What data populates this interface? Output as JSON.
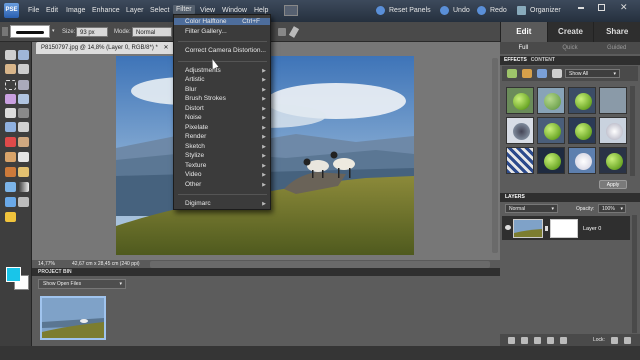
{
  "app": {
    "logo": "PSE"
  },
  "menubar": {
    "items": [
      "File",
      "Edit",
      "Image",
      "Enhance",
      "Layer",
      "Select",
      "Filter",
      "View",
      "Window",
      "Help"
    ],
    "active": "Filter",
    "reset_panels": "Reset Panels",
    "undo": "Undo",
    "redo": "Redo",
    "organizer": "Organizer"
  },
  "options": {
    "size_label": "Size:",
    "size_value": "93 px",
    "mode_label": "Mode:",
    "mode_value": "Normal"
  },
  "document": {
    "tab_title": "P8150797.jpg @ 14,8% (Layer 0, RGB/8*) *",
    "zoom": "14,77%",
    "doc_size": "42,67 cm x 28,45 cm (240 ppi)"
  },
  "filter_menu": {
    "items": [
      {
        "label": "Color Halftone",
        "shortcut": "Ctrl+F"
      },
      {
        "label": "Filter Gallery..."
      },
      {
        "label": "Correct Camera Distortion..."
      },
      {
        "label": "Adjustments",
        "submenu": true
      },
      {
        "label": "Artistic",
        "submenu": true
      },
      {
        "label": "Blur",
        "submenu": true
      },
      {
        "label": "Brush Strokes",
        "submenu": true
      },
      {
        "label": "Distort",
        "submenu": true
      },
      {
        "label": "Noise",
        "submenu": true
      },
      {
        "label": "Pixelate",
        "submenu": true
      },
      {
        "label": "Render",
        "submenu": true
      },
      {
        "label": "Sketch",
        "submenu": true
      },
      {
        "label": "Stylize",
        "submenu": true
      },
      {
        "label": "Texture",
        "submenu": true
      },
      {
        "label": "Video",
        "submenu": true
      },
      {
        "label": "Other",
        "submenu": true
      },
      {
        "label": "Digimarc",
        "submenu": true
      }
    ]
  },
  "project_bin": {
    "title": "PROJECT BIN",
    "select_value": "Show Open Files"
  },
  "panel": {
    "tabs": [
      "Edit",
      "Create",
      "Share"
    ],
    "active_tab": "Edit",
    "subtabs": [
      "Full",
      "Quick",
      "Guided"
    ],
    "active_subtab": "Full"
  },
  "effects": {
    "tabs": [
      "EFFECTS",
      "CONTENT"
    ],
    "filter_value": "Show All",
    "apply_label": "Apply"
  },
  "layers": {
    "title": "LAYERS",
    "blend_mode": "Normal",
    "opacity_label": "Opacity:",
    "opacity_value": "100%",
    "layer_name": "Layer 0",
    "lock_label": "Lock:"
  },
  "colors": {
    "foreground": "#19c5e9",
    "background": "#ffffff",
    "menu_highlight": "#4d6d9c"
  }
}
